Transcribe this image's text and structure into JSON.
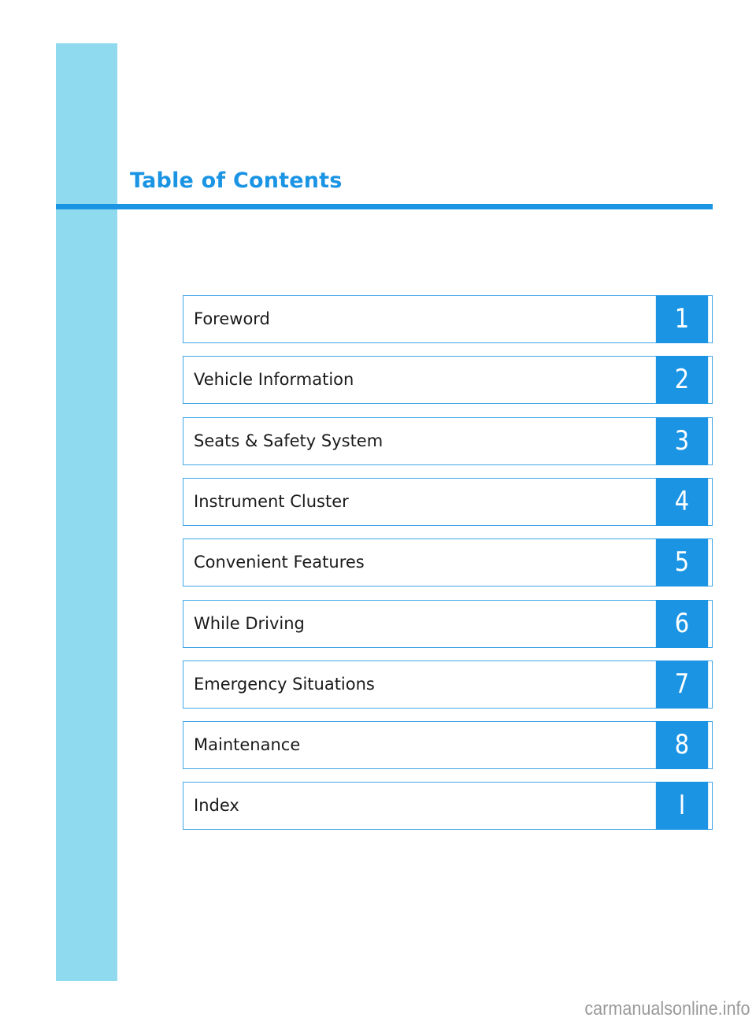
{
  "page": {
    "title": "Table of Contents",
    "accent_color": "#1b94e4",
    "sidebar_color": "#8fdaef"
  },
  "toc": {
    "items": [
      {
        "label": "Foreword",
        "number": "1"
      },
      {
        "label": "Vehicle Information",
        "number": "2"
      },
      {
        "label": "Seats & Safety System",
        "number": "3"
      },
      {
        "label": "Instrument Cluster",
        "number": "4"
      },
      {
        "label": "Convenient Features",
        "number": "5"
      },
      {
        "label": "While Driving",
        "number": "6"
      },
      {
        "label": "Emergency Situations",
        "number": "7"
      },
      {
        "label": "Maintenance",
        "number": "8"
      },
      {
        "label": "Index",
        "number": "I"
      }
    ]
  },
  "footer": {
    "watermark": "carmanualsonline.info"
  }
}
